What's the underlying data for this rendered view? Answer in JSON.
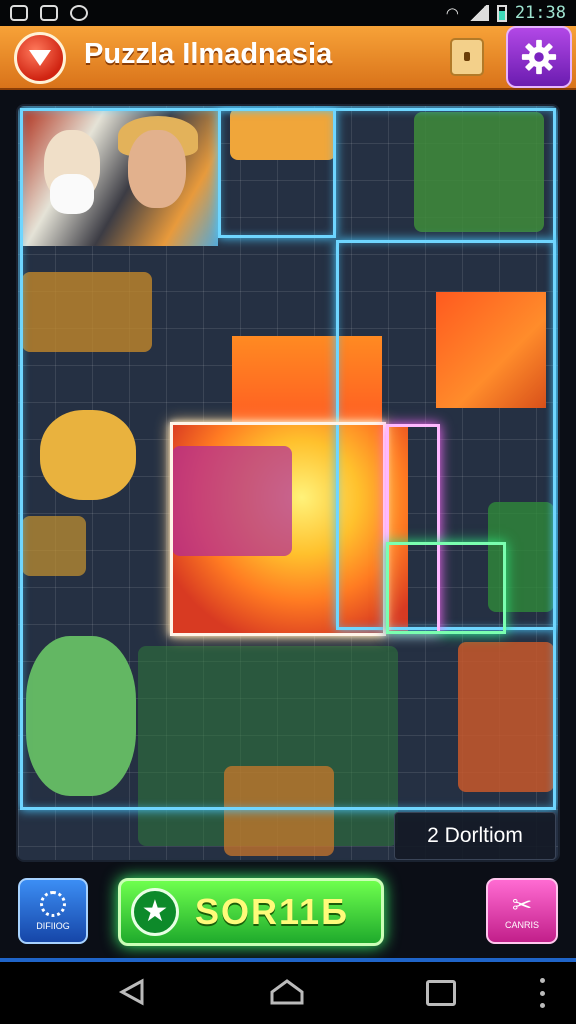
{
  "status_bar": {
    "time": "21:38",
    "icons": [
      "notification-icon",
      "image-icon",
      "mute-icon",
      "wifi-icon",
      "signal-icon",
      "battery-icon"
    ]
  },
  "header": {
    "title": "Puzzla Ilmadnasia",
    "back_icon": "back-arrow-icon",
    "bag_icon": "bag-icon",
    "settings_icon": "gear-icon",
    "colors": {
      "header": "#e98a28",
      "settings": "#8a2fd0",
      "back": "#e0341c"
    }
  },
  "board": {
    "status_text": "2 Dorltiom"
  },
  "bottom": {
    "hint_label": "DIFIIOG",
    "main_label": "SOR11Б",
    "shuffle_label": "CANRIS",
    "colors": {
      "hint": "#2a6fd8",
      "main": "#33cc3a",
      "shuffle": "#e03aa8"
    }
  },
  "nav": {
    "back_icon": "nav-back-icon",
    "home_icon": "nav-home-icon",
    "recent_icon": "nav-recent-icon",
    "more_icon": "nav-more-icon"
  }
}
